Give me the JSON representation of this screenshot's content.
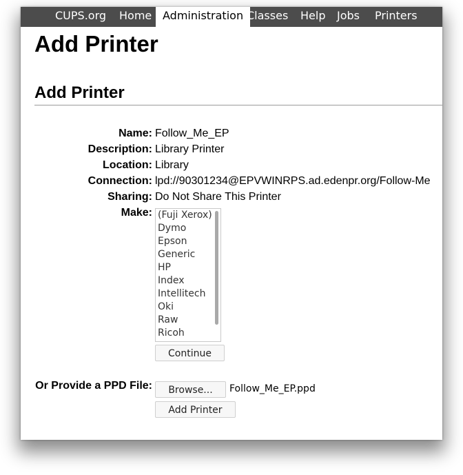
{
  "nav": {
    "items": [
      {
        "label": "CUPS.org"
      },
      {
        "label": "Home"
      },
      {
        "label": "Administration",
        "active": true
      },
      {
        "label": "Classes"
      },
      {
        "label": "Help"
      },
      {
        "label": "Jobs"
      },
      {
        "label": "Printers"
      }
    ]
  },
  "page": {
    "title": "Add Printer",
    "section_title": "Add Printer"
  },
  "fields": {
    "name": {
      "label": "Name:",
      "value": "Follow_Me_EP"
    },
    "description": {
      "label": "Description:",
      "value": "Library Printer"
    },
    "location": {
      "label": "Location:",
      "value": "Library"
    },
    "connection": {
      "label": "Connection:",
      "value": "lpd://90301234@EPVWINRPS.ad.edenpr.org/Follow-Me"
    },
    "sharing": {
      "label": "Sharing:",
      "value": "Do Not Share This Printer"
    },
    "make": {
      "label": "Make:",
      "options": [
        "(Fuji Xerox)",
        "Dymo",
        "Epson",
        "Generic",
        "HP",
        "Index",
        "Intellitech",
        "Oki",
        "Raw",
        "Ricoh"
      ]
    }
  },
  "buttons": {
    "continue": "Continue",
    "browse": "Browse...",
    "add_printer": "Add Printer"
  },
  "ppd": {
    "label": "Or Provide a PPD File:",
    "filename": "Follow_Me_EP.ppd"
  },
  "colors": {
    "navbar_bg": "#4c4c4c",
    "nav_text": "#ffffff",
    "active_tab_bg": "#ffffff"
  }
}
